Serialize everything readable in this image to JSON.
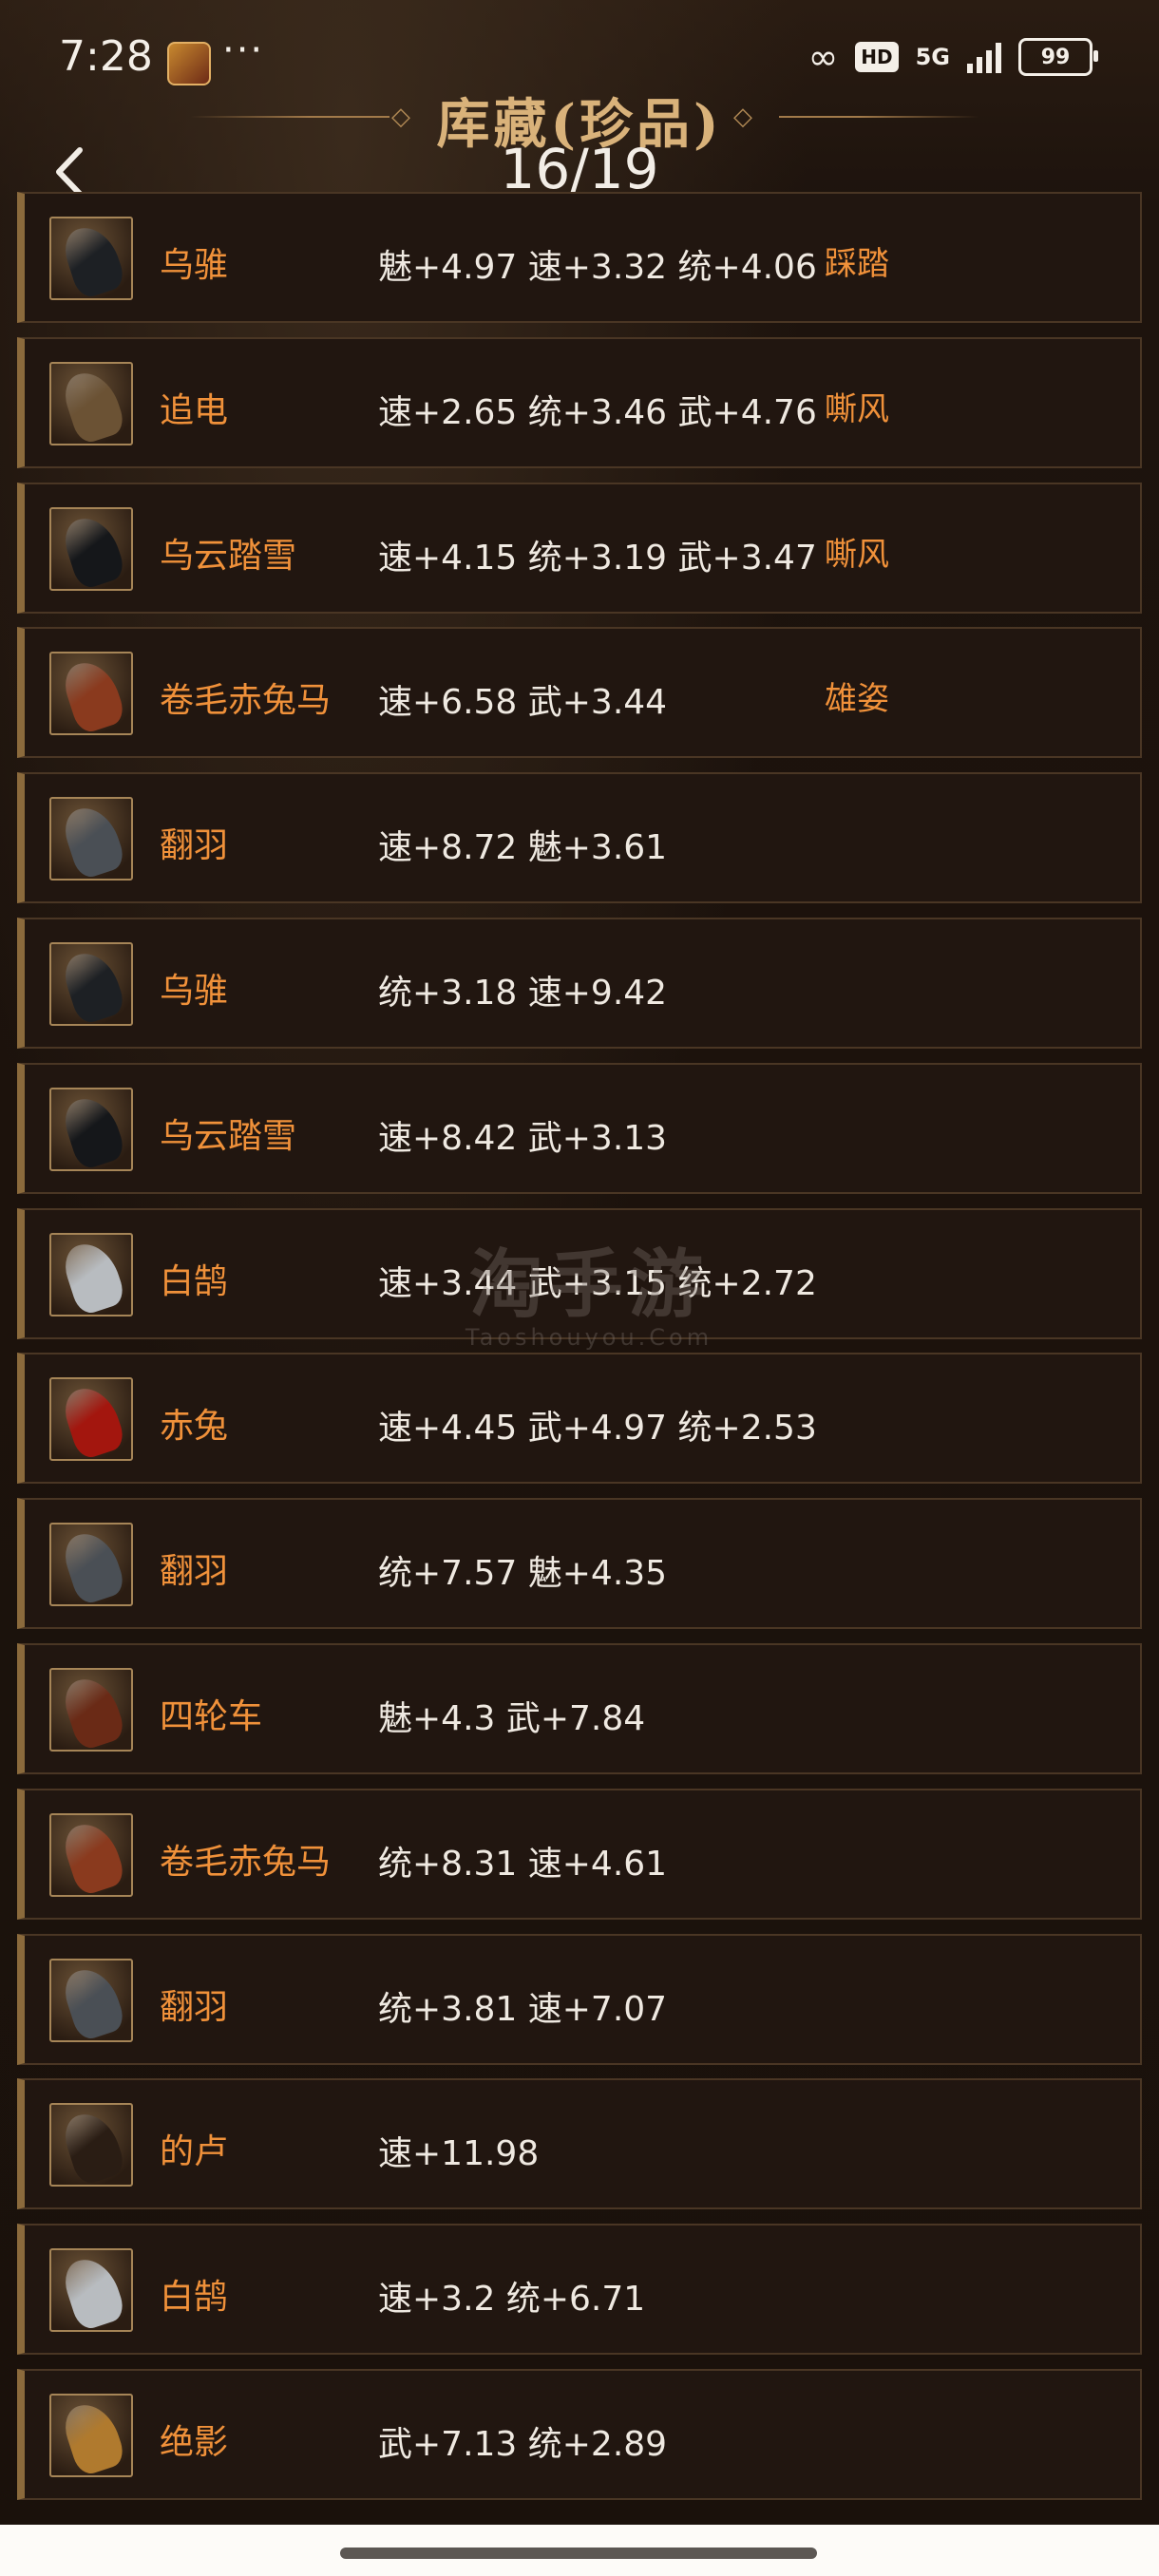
{
  "status_bar": {
    "time": "7:28",
    "hd": "HD",
    "signal": "5G",
    "battery": "99"
  },
  "header": {
    "title": "库藏(珍品)",
    "page": "16/19"
  },
  "items": [
    {
      "name": "乌骓",
      "stats": "魅+4.97 速+3.32 统+4.06",
      "skill": "踩踏",
      "thumb_color": "#1d2024"
    },
    {
      "name": "追电",
      "stats": "速+2.65 统+3.46 武+4.76",
      "skill": "嘶风",
      "thumb_color": "#6b5234"
    },
    {
      "name": "乌云踏雪",
      "stats": "速+4.15 统+3.19 武+3.47",
      "skill": "嘶风",
      "thumb_color": "#15171a"
    },
    {
      "name": "卷毛赤兔马",
      "stats": "速+6.58 武+3.44",
      "skill": "雄姿",
      "thumb_color": "#8a3a1e"
    },
    {
      "name": "翻羽",
      "stats": "速+8.72 魅+3.61",
      "skill": "",
      "thumb_color": "#4a4f55"
    },
    {
      "name": "乌骓",
      "stats": "统+3.18 速+9.42",
      "skill": "",
      "thumb_color": "#1d2024"
    },
    {
      "name": "乌云踏雪",
      "stats": "速+8.42 武+3.13",
      "skill": "",
      "thumb_color": "#15171a"
    },
    {
      "name": "白鹄",
      "stats": "速+3.44 武+3.15 统+2.72",
      "skill": "",
      "thumb_color": "#b8bcc0"
    },
    {
      "name": "赤兔",
      "stats": "速+4.45 武+4.97 统+2.53",
      "skill": "",
      "thumb_color": "#a3160e"
    },
    {
      "name": "翻羽",
      "stats": "统+7.57 魅+4.35",
      "skill": "",
      "thumb_color": "#4a4f55"
    },
    {
      "name": "四轮车",
      "stats": "魅+4.3 武+7.84",
      "skill": "",
      "thumb_color": "#6a2a16"
    },
    {
      "name": "卷毛赤兔马",
      "stats": "统+8.31 速+4.61",
      "skill": "",
      "thumb_color": "#8a3a1e"
    },
    {
      "name": "翻羽",
      "stats": "统+3.81 速+7.07",
      "skill": "",
      "thumb_color": "#4a4f55"
    },
    {
      "name": "的卢",
      "stats": "速+11.98",
      "skill": "",
      "thumb_color": "#2a1d14"
    },
    {
      "name": "白鹄",
      "stats": "速+3.2 统+6.71",
      "skill": "",
      "thumb_color": "#b8bcc0"
    },
    {
      "name": "绝影",
      "stats": "武+7.13 统+2.89",
      "skill": "",
      "thumb_color": "#b07a2e"
    }
  ],
  "watermark": {
    "main": "淘手游",
    "sub": "Taoshouyou.Com"
  }
}
